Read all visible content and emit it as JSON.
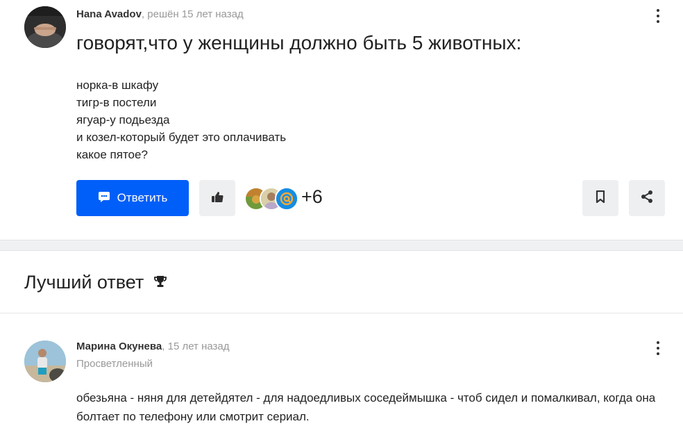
{
  "question": {
    "author_name": "Hana Avadov",
    "status_time": ", решён 15 лет назад",
    "title": "говорят,что у женщины должно быть 5 животных:",
    "body_lines": [
      "норка-в шкафу",
      "тигр-в постели",
      "ягуар-у подьезда",
      "и козел-который будет это оплачивать",
      "какое пятое?"
    ],
    "answer_button_label": "Ответить",
    "likes_more": "+6"
  },
  "best_answer": {
    "section_title": "Лучший ответ",
    "author_name": "Марина Окунева",
    "time": ", 15 лет назад",
    "rank": "Просветленный",
    "text": "обезьяна - няня для детейдятел - для надоедливых соседеймышка - чтоб сидел и помалкивал, когда она болтает по телефону или смотрит сериал."
  },
  "colors": {
    "accent": "#005ff9",
    "button_bg": "#eeeff1",
    "muted_text": "#999999"
  },
  "icons": [
    "more-vertical-icon",
    "chat-icon",
    "thumbs-up-icon",
    "bookmark-icon",
    "share-icon",
    "trophy-icon",
    "mail-at-icon"
  ]
}
